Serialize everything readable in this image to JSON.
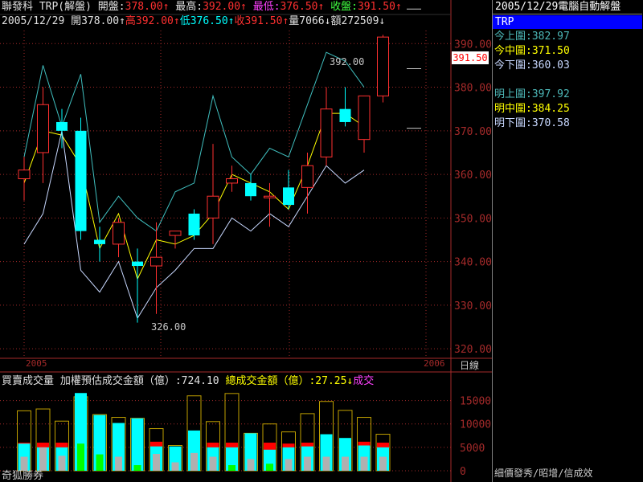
{
  "header": {
    "line1": {
      "name": "聯發科 TRP(解盤)",
      "open_label": "開盤:",
      "open_val": "378.00↑",
      "high_label": "最高:",
      "high_val": "392.00↑",
      "low_label": "最低:",
      "low_val": "376.50↑",
      "close_label": "收盤:",
      "close_val": "391.50↑",
      "flag": "↑"
    },
    "line2": {
      "date": "2005/12/29",
      "open": "開378.00↑",
      "high": "高392.00↑",
      "low": "低376.50↑",
      "close": "收391.50↑",
      "vol": "量7066↓",
      "amt": "額272509↓"
    }
  },
  "price_chart": {
    "price_tag": "391.50",
    "high_annot": "392.00",
    "low_annot": "326.00",
    "year_left": "2005",
    "year_right": "2006",
    "period": "日線",
    "yaxis_ticks": [
      "390.00",
      "380.00",
      "370.00",
      "360.00",
      "350.00",
      "340.00",
      "330.00",
      "320.00"
    ]
  },
  "volume_panel": {
    "title": "買賣成交量",
    "weighted_label": "加權預估成交金額（億）:724.10",
    "total_label": "總成交金額（億）:27.25↓",
    "extra_label": "成交",
    "yaxis_ticks": [
      "15000",
      "10000",
      "5000",
      "0"
    ]
  },
  "footer": {
    "left": "奇狐勝券",
    "right": "細價發秀/昭增/信成效"
  },
  "right_panel": {
    "title": "2005/12/29電腦自動解盤",
    "tab": "TRP",
    "today": [
      {
        "label": "今上圍:",
        "value": "382.97",
        "color": "#4db8b8"
      },
      {
        "label": "今中圍:",
        "value": "371.50",
        "color": "#ffff00"
      },
      {
        "label": "今下圍:",
        "value": "360.03",
        "color": "#c8d8ff"
      }
    ],
    "tomorrow": [
      {
        "label": "明上圍:",
        "value": "397.92",
        "color": "#4db8b8"
      },
      {
        "label": "明中圍:",
        "value": "384.25",
        "color": "#ffff00"
      },
      {
        "label": "明下圍:",
        "value": "370.58",
        "color": "#c8d8ff"
      }
    ]
  },
  "colors": {
    "up": "#ff3030",
    "down": "#00ffff",
    "mid": "#ffff00",
    "upper": "#40c0c0",
    "lower": "#c8d8ff"
  },
  "chart_data": {
    "type": "candlestick",
    "ylim": [
      318,
      393
    ],
    "candles": [
      {
        "o": 359,
        "h": 364,
        "l": 354,
        "c": 361
      },
      {
        "o": 365,
        "h": 380,
        "l": 358,
        "c": 376
      },
      {
        "o": 372,
        "h": 375,
        "l": 366,
        "c": 370
      },
      {
        "o": 370,
        "h": 373,
        "l": 345,
        "c": 347
      },
      {
        "o": 345,
        "h": 348,
        "l": 340,
        "c": 344
      },
      {
        "o": 344,
        "h": 350,
        "l": 341,
        "c": 349
      },
      {
        "o": 340,
        "h": 343,
        "l": 326,
        "c": 339
      },
      {
        "o": 339,
        "h": 349,
        "l": 328,
        "c": 341
      },
      {
        "o": 346,
        "h": 347,
        "l": 343,
        "c": 347
      },
      {
        "o": 351,
        "h": 352,
        "l": 345,
        "c": 346
      },
      {
        "o": 350,
        "h": 367,
        "l": 344,
        "c": 355
      },
      {
        "o": 358,
        "h": 362,
        "l": 356,
        "c": 359
      },
      {
        "o": 358,
        "h": 360,
        "l": 354,
        "c": 355
      },
      {
        "o": 355,
        "h": 358,
        "l": 348,
        "c": 355
      },
      {
        "o": 357,
        "h": 361,
        "l": 352,
        "c": 353
      },
      {
        "o": 357,
        "h": 365,
        "l": 351,
        "c": 362
      },
      {
        "o": 364,
        "h": 380,
        "l": 362,
        "c": 375
      },
      {
        "o": 375,
        "h": 380,
        "l": 371,
        "c": 372
      },
      {
        "o": 368,
        "h": 377,
        "l": 365,
        "c": 378
      },
      {
        "o": 378,
        "h": 392,
        "l": 376.5,
        "c": 391.5
      }
    ],
    "mid_line": [
      358,
      370,
      369,
      362,
      343,
      351,
      336,
      345,
      344,
      346,
      351,
      360,
      358,
      356,
      352,
      362,
      374,
      374,
      371,
      null
    ],
    "upper_line": [
      364,
      385,
      371,
      383,
      349,
      355,
      350,
      347,
      356,
      358,
      378,
      364,
      360,
      366,
      364,
      376,
      388,
      386,
      380,
      null
    ],
    "lower_line": [
      344,
      351,
      370,
      338,
      333,
      340,
      327,
      334,
      338,
      343,
      343,
      350,
      347,
      351,
      348,
      355,
      362,
      358,
      361,
      null
    ],
    "next_levels": {
      "upper": 397.92,
      "mid": 384.25,
      "lower": 370.58
    },
    "volume_max": 17500,
    "volume": [
      {
        "total": 12800,
        "up": 6000,
        "down": 5800,
        "green": 0,
        "grey": 3000
      },
      {
        "total": 13200,
        "up": 6000,
        "down": 5000,
        "green": 0,
        "grey": 5000
      },
      {
        "total": 10600,
        "up": 6000,
        "down": 5000,
        "green": 0,
        "grey": 3200
      },
      {
        "total": 15800,
        "up": 6000,
        "down": 16600,
        "green": 5800,
        "grey": 0
      },
      {
        "total": 12000,
        "up": 6000,
        "down": 11900,
        "green": 3500,
        "grey": 0
      },
      {
        "total": 11400,
        "up": 6000,
        "down": 10200,
        "green": 0,
        "grey": 3000
      },
      {
        "total": 11200,
        "up": 5800,
        "down": 11200,
        "green": 1200,
        "grey": 0
      },
      {
        "total": 9000,
        "up": 6200,
        "down": 5200,
        "green": 0,
        "grey": 3600
      },
      {
        "total": 5400,
        "up": 1800,
        "down": 5200,
        "green": 1200,
        "grey": 1800
      },
      {
        "total": 16000,
        "up": 6000,
        "down": 8600,
        "green": 0,
        "grey": 3800
      },
      {
        "total": 10500,
        "up": 6000,
        "down": 5000,
        "green": 0,
        "grey": 3000
      },
      {
        "total": 16500,
        "up": 6000,
        "down": 5000,
        "green": 1200,
        "grey": 0
      },
      {
        "total": 8000,
        "up": 6400,
        "down": 8000,
        "green": 0,
        "grey": 2500
      },
      {
        "total": 10000,
        "up": 6000,
        "down": 4500,
        "green": 1500,
        "grey": 0
      },
      {
        "total": 8300,
        "up": 5800,
        "down": 5000,
        "green": 0,
        "grey": 2500
      },
      {
        "total": 12200,
        "up": 6000,
        "down": 5200,
        "green": 0,
        "grey": 3000
      },
      {
        "total": 14800,
        "up": 6000,
        "down": 7800,
        "green": 0,
        "grey": 3000
      },
      {
        "total": 12900,
        "up": 6200,
        "down": 7000,
        "green": 0,
        "grey": 3000
      },
      {
        "total": 11400,
        "up": 6200,
        "down": 5400,
        "green": 0,
        "grey": 3000
      },
      {
        "total": 7800,
        "up": 6000,
        "down": 5000,
        "green": 0,
        "grey": 3000
      }
    ]
  }
}
